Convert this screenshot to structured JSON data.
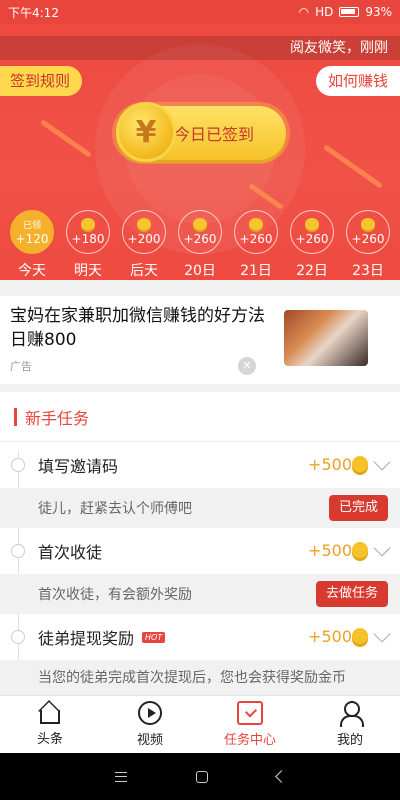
{
  "status_bar": {
    "time": "下午4:12",
    "network": "HD",
    "battery": "93%"
  },
  "hero": {
    "ticker": "阅友微笑，刚刚",
    "rules_label": "签到规则",
    "earn_label": "如何赚钱",
    "sign_label": "今日已签到",
    "coin_symbol": "¥",
    "days": [
      {
        "tag": "已领",
        "reward": "+120",
        "label": "今天"
      },
      {
        "reward": "+180",
        "label": "明天"
      },
      {
        "reward": "+200",
        "label": "后天"
      },
      {
        "reward": "+260",
        "label": "20日"
      },
      {
        "reward": "+260",
        "label": "21日"
      },
      {
        "reward": "+260",
        "label": "22日"
      },
      {
        "reward": "+260",
        "label": "23日"
      }
    ]
  },
  "ad": {
    "title": "宝妈在家兼职加微信赚钱的好方法 日赚800",
    "source": "广告",
    "close": "✕"
  },
  "tasks": {
    "section_title": "新手任务",
    "items": [
      {
        "name": "填写邀请码",
        "reward": "+500",
        "desc": "徒儿，赶紧去认个师傅吧",
        "button": "已完成"
      },
      {
        "name": "首次收徒",
        "reward": "+500",
        "desc": "首次收徒，有会额外奖励",
        "button": "去做任务"
      },
      {
        "name": "徒弟提现奖励",
        "hot": "HOT",
        "reward": "+500",
        "desc": "当您的徒弟完成首次提现后，您也会获得奖励金币"
      }
    ]
  },
  "nav": {
    "items": [
      "头条",
      "视频",
      "任务中心",
      "我的"
    ]
  }
}
